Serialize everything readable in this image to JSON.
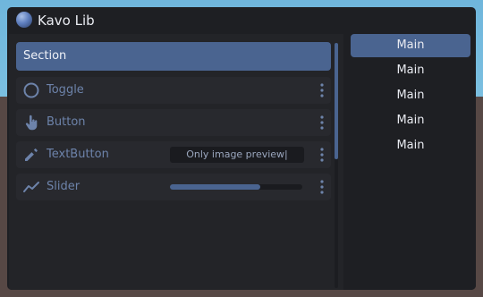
{
  "window": {
    "title": "Kavo Lib"
  },
  "section": {
    "title": "Section"
  },
  "elements": {
    "toggle": {
      "label": "Toggle"
    },
    "button": {
      "label": "Button"
    },
    "textbutton": {
      "label": "TextButton",
      "input_value": "Only image preview|"
    },
    "slider": {
      "label": "Slider",
      "value_fraction": 0.68
    }
  },
  "tabs": [
    "Main",
    "Main",
    "Main",
    "Main",
    "Main"
  ],
  "colors": {
    "accent": "#4a6490",
    "window_bg": "#1e1f23",
    "label": "#6d83aa"
  },
  "icons": [
    "toggle-circle-icon",
    "hand-pointer-icon",
    "pencil-icon",
    "trend-line-icon",
    "more-vertical-icon"
  ]
}
